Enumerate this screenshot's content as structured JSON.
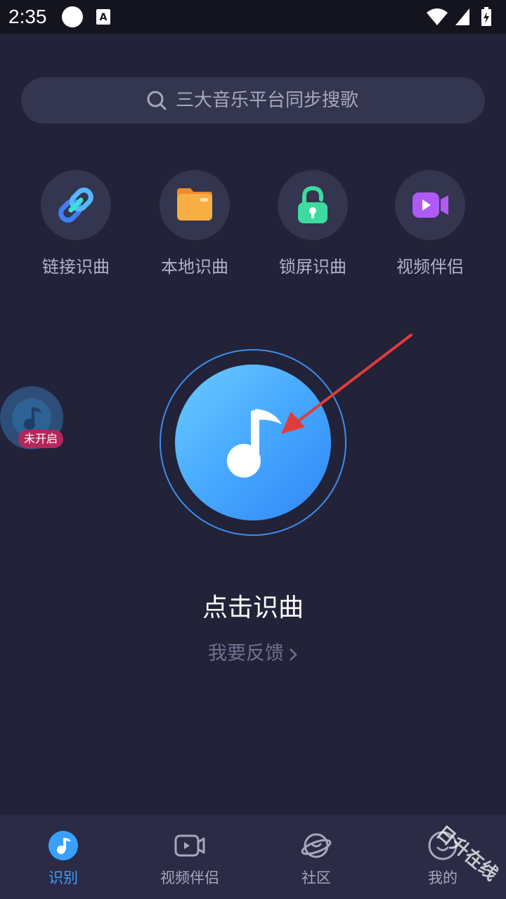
{
  "status_bar": {
    "time": "2:35"
  },
  "search": {
    "placeholder": "三大音乐平台同步搜歌",
    "icon": "search-icon"
  },
  "features": [
    {
      "label": "链接识曲",
      "icon": "link-icon",
      "color": "#4a8cf7"
    },
    {
      "label": "本地识曲",
      "icon": "folder-icon",
      "color": "#f6a03b"
    },
    {
      "label": "锁屏识曲",
      "icon": "lock-icon",
      "color": "#3ddb9f"
    },
    {
      "label": "视频伴侣",
      "icon": "video-camera-icon",
      "color": "#b05af5"
    }
  ],
  "float_widget": {
    "badge": "未开启",
    "icon": "music-note-icon"
  },
  "main": {
    "tap_title": "点击识曲",
    "feedback": "我要反馈",
    "accent": "#47a8ff"
  },
  "bottom_nav": {
    "items": [
      {
        "label": "识别",
        "icon": "music-note-icon",
        "active": true
      },
      {
        "label": "视频伴侣",
        "icon": "video-icon",
        "active": false
      },
      {
        "label": "社区",
        "icon": "planet-icon",
        "active": false
      },
      {
        "label": "我的",
        "icon": "profile-icon",
        "active": false
      }
    ]
  },
  "watermark": "日升在线"
}
